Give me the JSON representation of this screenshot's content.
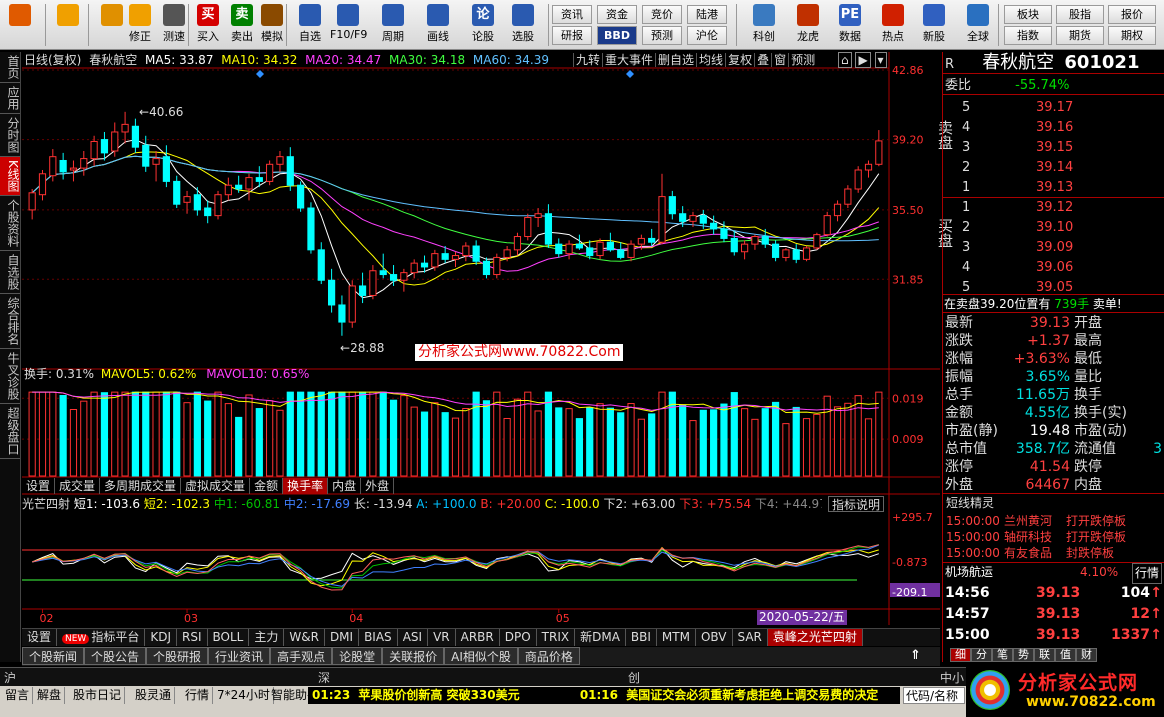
{
  "toolbar": {
    "big": [
      {
        "label": "",
        "icon": "home-grid-icon",
        "color": "#e05a00"
      },
      {
        "label": "",
        "icon": "back-arrow-icon",
        "color": "#f0a000"
      },
      {
        "label": "",
        "icon": "updown-arrow-icon",
        "color": "#e09000"
      },
      {
        "label": "修正",
        "icon": "refresh-icon",
        "color": "#f0a000"
      },
      {
        "label": "测速",
        "icon": "clock-icon",
        "color": "#555555"
      },
      {
        "label": "买入",
        "icon": "buy-icon",
        "color": "#d40000",
        "glyph": "买"
      },
      {
        "label": "卖出",
        "icon": "sell-icon",
        "color": "#008000",
        "glyph": "卖"
      },
      {
        "label": "模拟",
        "icon": "hammer-icon",
        "color": "#8a4a00"
      },
      {
        "label": "自选",
        "icon": "star-icon",
        "color": "#2a5ab0"
      },
      {
        "label": "F10/F9",
        "icon": "f10-icon",
        "color": "#2a5ab0"
      },
      {
        "label": "周期",
        "icon": "period-icon",
        "color": "#2a5ab0"
      },
      {
        "label": "画线",
        "icon": "pencil-icon",
        "color": "#2a5ab0"
      },
      {
        "label": "论股",
        "icon": "chat-icon",
        "color": "#2a5ab0",
        "glyph": "论"
      },
      {
        "label": "选股",
        "icon": "select-icon",
        "color": "#2a5ab0"
      }
    ],
    "small": [
      "资讯",
      "资金",
      "竞价",
      "陆港",
      "研报",
      "BBD",
      "预测",
      "沪伦"
    ],
    "big2": [
      {
        "label": "科创",
        "icon": "chart-icon",
        "color": "#3a7ac0"
      },
      {
        "label": "龙虎",
        "icon": "dragon-icon",
        "color": "#c03000"
      },
      {
        "label": "数据",
        "icon": "pe-icon",
        "color": "#3060c0",
        "glyph": "PE"
      },
      {
        "label": "热点",
        "icon": "hot-icon",
        "color": "#d02000"
      },
      {
        "label": "新股",
        "icon": "ipo-icon",
        "color": "#3060c0"
      },
      {
        "label": "全球",
        "icon": "globe-icon",
        "color": "#2a70c0"
      }
    ],
    "small2": [
      "板块",
      "股指",
      "报价",
      "指数",
      "期货",
      "期权"
    ]
  },
  "left_tabs": [
    "首页",
    "应用",
    "分时图",
    "K线图",
    "个股资料",
    "自选股",
    "综合排名",
    "牛叉诊股",
    "超级盘口"
  ],
  "chart": {
    "header": {
      "period": "日线(复权)",
      "name": "春秋航空",
      "ma5": "MA5: 33.87",
      "ma10": "MA10: 34.32",
      "ma20": "MA20: 34.47",
      "ma30": "MA30: 34.18",
      "ma60": "MA60: 34.39"
    },
    "top_buttons": [
      "九转",
      "重大事件",
      "删自选",
      "均线",
      "复权",
      "叠",
      "窗",
      "预测"
    ],
    "price_ticks": [
      "42.86",
      "39.20",
      "35.50",
      "31.85"
    ],
    "hi_label": "40.66",
    "lo_label": "28.88",
    "watermark": "分析家公式网www.70822.Com",
    "vol_header": {
      "hs": "换手: 0.31%",
      "mv5": "MAVOL5: 0.62%",
      "mv10": "MAVOL10: 0.65%"
    },
    "vol_ticks": [
      "0.019",
      "0.009"
    ],
    "vol_tabs": [
      "设置",
      "成交量",
      "多周期成交量",
      "虚拟成交量",
      "金额",
      "换手率",
      "内盘",
      "外盘"
    ],
    "ind_header": {
      "name": "光芒四射",
      "s1": "短1: -103.6",
      "s2": "短2: -102.3",
      "z1": "中1: -60.81",
      "z2": "中2: -17.69",
      "l": "长: -13.94",
      "a": "A: +100.0",
      "b": "B: +20.00",
      "c": "C: -100.0",
      "x2": "下2: +63.00",
      "x3": "下3: +75.54",
      "x4": "下4: +44.97"
    },
    "ind_button": "指标说明",
    "ind_ticks": [
      "+295.7",
      "-0.873",
      "-209.1"
    ],
    "months": [
      "02",
      "03",
      "04",
      "05"
    ],
    "date_label": "2020-05-22/五"
  },
  "chart_data": {
    "type": "candlestick",
    "ohlc": [
      [
        35.5,
        36.6,
        35.0,
        36.4
      ],
      [
        36.3,
        37.6,
        36.0,
        37.4
      ],
      [
        37.3,
        38.7,
        37.0,
        38.3
      ],
      [
        38.1,
        38.5,
        37.1,
        37.5
      ],
      [
        37.6,
        38.1,
        37.0,
        37.7
      ],
      [
        37.7,
        38.6,
        37.3,
        38.2
      ],
      [
        38.2,
        39.4,
        37.8,
        39.1
      ],
      [
        39.2,
        39.6,
        38.1,
        38.5
      ],
      [
        38.6,
        40.1,
        38.3,
        39.6
      ],
      [
        39.6,
        40.66,
        39.0,
        40.0
      ],
      [
        39.9,
        40.3,
        38.5,
        38.8
      ],
      [
        38.9,
        39.4,
        37.5,
        37.8
      ],
      [
        37.9,
        38.6,
        37.0,
        38.2
      ],
      [
        38.3,
        38.9,
        36.7,
        37.0
      ],
      [
        37.0,
        37.3,
        35.6,
        35.8
      ],
      [
        35.9,
        36.5,
        35.3,
        36.2
      ],
      [
        36.3,
        36.7,
        35.2,
        35.5
      ],
      [
        35.6,
        36.0,
        34.8,
        35.2
      ],
      [
        35.2,
        36.5,
        35.0,
        36.3
      ],
      [
        36.3,
        37.2,
        36.0,
        36.8
      ],
      [
        36.8,
        37.3,
        36.4,
        36.6
      ],
      [
        36.6,
        37.4,
        36.0,
        37.2
      ],
      [
        37.2,
        37.8,
        36.7,
        37.0
      ],
      [
        37.0,
        38.1,
        36.8,
        37.9
      ],
      [
        37.9,
        38.6,
        37.5,
        38.3
      ],
      [
        38.3,
        38.8,
        36.5,
        36.8
      ],
      [
        36.8,
        37.0,
        35.4,
        35.6
      ],
      [
        35.6,
        35.9,
        33.2,
        33.4
      ],
      [
        33.4,
        33.8,
        31.6,
        31.8
      ],
      [
        31.8,
        32.4,
        30.1,
        30.5
      ],
      [
        30.5,
        31.0,
        28.88,
        29.6
      ],
      [
        29.6,
        31.8,
        29.3,
        31.5
      ],
      [
        31.5,
        32.2,
        30.6,
        31.0
      ],
      [
        31.0,
        32.6,
        30.8,
        32.3
      ],
      [
        32.3,
        33.2,
        31.9,
        32.1
      ],
      [
        32.1,
        32.6,
        31.5,
        31.8
      ],
      [
        31.8,
        32.4,
        31.2,
        32.2
      ],
      [
        32.2,
        32.9,
        31.9,
        32.7
      ],
      [
        32.7,
        33.1,
        32.2,
        32.5
      ],
      [
        32.5,
        33.4,
        32.3,
        33.2
      ],
      [
        33.2,
        33.6,
        32.7,
        32.9
      ],
      [
        32.9,
        33.3,
        32.5,
        33.1
      ],
      [
        33.1,
        33.8,
        32.8,
        33.6
      ],
      [
        33.6,
        33.9,
        32.6,
        32.8
      ],
      [
        32.8,
        33.0,
        31.9,
        32.1
      ],
      [
        32.1,
        33.2,
        31.9,
        33.0
      ],
      [
        33.0,
        33.6,
        32.8,
        33.4
      ],
      [
        33.4,
        34.3,
        33.1,
        34.1
      ],
      [
        34.1,
        35.3,
        33.9,
        35.1
      ],
      [
        35.1,
        35.6,
        34.6,
        35.3
      ],
      [
        35.3,
        35.8,
        33.5,
        33.7
      ],
      [
        33.7,
        34.0,
        33.0,
        33.2
      ],
      [
        33.2,
        33.9,
        32.9,
        33.7
      ],
      [
        33.7,
        34.2,
        33.4,
        33.5
      ],
      [
        33.5,
        33.9,
        32.9,
        33.1
      ],
      [
        33.1,
        34.0,
        32.9,
        33.8
      ],
      [
        33.8,
        34.3,
        33.3,
        33.4
      ],
      [
        33.4,
        33.8,
        32.9,
        33.0
      ],
      [
        33.0,
        33.9,
        32.8,
        33.7
      ],
      [
        33.7,
        34.2,
        33.4,
        34.0
      ],
      [
        34.0,
        34.5,
        33.6,
        33.8
      ],
      [
        33.8,
        37.4,
        33.7,
        36.2
      ],
      [
        36.2,
        36.5,
        35.0,
        35.3
      ],
      [
        35.3,
        35.7,
        34.6,
        34.9
      ],
      [
        34.9,
        35.4,
        34.6,
        35.2
      ],
      [
        35.2,
        35.5,
        34.5,
        34.8
      ],
      [
        34.8,
        35.2,
        34.2,
        34.5
      ],
      [
        34.5,
        34.9,
        33.8,
        34.0
      ],
      [
        34.0,
        34.4,
        33.1,
        33.3
      ],
      [
        33.3,
        33.9,
        32.9,
        33.7
      ],
      [
        33.7,
        34.2,
        33.4,
        34.1
      ],
      [
        34.1,
        34.5,
        33.5,
        33.7
      ],
      [
        33.7,
        33.9,
        32.8,
        33.0
      ],
      [
        33.0,
        33.5,
        32.8,
        33.4
      ],
      [
        33.4,
        33.7,
        32.7,
        32.9
      ],
      [
        32.9,
        33.6,
        32.8,
        33.5
      ],
      [
        33.5,
        34.3,
        33.4,
        34.2
      ],
      [
        34.2,
        35.4,
        34.1,
        35.2
      ],
      [
        35.2,
        36.0,
        34.9,
        35.8
      ],
      [
        35.8,
        36.8,
        35.6,
        36.6
      ],
      [
        36.6,
        37.8,
        36.4,
        37.6
      ],
      [
        37.6,
        38.1,
        37.2,
        37.9
      ],
      [
        37.9,
        39.7,
        37.8,
        39.13
      ]
    ],
    "ylim": [
      27.5,
      42.86
    ]
  },
  "quote": {
    "code_label": "R",
    "name": "春秋航空",
    "code": "601021",
    "wb_label": "委比",
    "wb": "-55.74%",
    "sell_label": "卖盘",
    "buy_label": "买盘",
    "sells": [
      {
        "n": "5",
        "p": "39.17"
      },
      {
        "n": "4",
        "p": "39.16"
      },
      {
        "n": "3",
        "p": "39.15"
      },
      {
        "n": "2",
        "p": "39.14"
      },
      {
        "n": "1",
        "p": "39.13"
      }
    ],
    "buys": [
      {
        "n": "1",
        "p": "39.12"
      },
      {
        "n": "2",
        "p": "39.10"
      },
      {
        "n": "3",
        "p": "39.09"
      },
      {
        "n": "4",
        "p": "39.06"
      },
      {
        "n": "5",
        "p": "39.05"
      }
    ],
    "sell_info_a": "在卖盘39.20位置有",
    "sell_info_b": "739手",
    "sell_info_c": "卖单!",
    "stats": [
      {
        "l1": "最新",
        "v1": "39.13",
        "c1": "red",
        "l2": "开盘",
        "v2": "",
        "c2": "red"
      },
      {
        "l1": "涨跌",
        "v1": "+1.37",
        "c1": "red",
        "l2": "最高",
        "v2": "",
        "c2": "red"
      },
      {
        "l1": "涨幅",
        "v1": "+3.63%",
        "c1": "red",
        "l2": "最低",
        "v2": "",
        "c2": "red"
      },
      {
        "l1": "振幅",
        "v1": "3.65%",
        "c1": "cyn",
        "l2": "量比",
        "v2": "",
        "c2": "red"
      },
      {
        "l1": "总手",
        "v1": "11.65万",
        "c1": "cyn",
        "l2": "换手",
        "v2": "",
        "c2": "cyn"
      },
      {
        "l1": "金额",
        "v1": "4.55亿",
        "c1": "cyn",
        "l2": "换手(实)",
        "v2": "",
        "c2": "cyn"
      },
      {
        "l1": "市盈(静)",
        "v1": "19.48",
        "c1": "wht",
        "l2": "市盈(动)",
        "v2": "",
        "c2": "wht"
      },
      {
        "l1": "总市值",
        "v1": "358.7亿",
        "c1": "cyn",
        "l2": "流通值",
        "v2": "3",
        "c2": "cyn"
      },
      {
        "l1": "涨停",
        "v1": "41.54",
        "c1": "red",
        "l2": "跌停",
        "v2": "",
        "c2": "grn"
      },
      {
        "l1": "外盘",
        "v1": "64467",
        "c1": "red",
        "l2": "内盘",
        "v2": "",
        "c2": "grn"
      }
    ],
    "elves_title": "短线精灵",
    "elves": [
      {
        "t": "15:00:00",
        "s": "兰州黄河",
        "e": "打开跌停板"
      },
      {
        "t": "15:00:00",
        "s": "轴研科技",
        "e": "打开跌停板"
      },
      {
        "t": "15:00:00",
        "s": "有友食品",
        "e": "封跌停板"
      }
    ],
    "sector": {
      "name": "机场航运",
      "pct": "4.10%",
      "btn": "行情"
    },
    "ticks": [
      {
        "t": "14:56",
        "p": "39.13",
        "v": "104",
        "d": "↑"
      },
      {
        "t": "14:57",
        "p": "39.13",
        "v": "12",
        "d": "↑"
      },
      {
        "t": "15:00",
        "p": "39.13",
        "v": "1337",
        "d": "↑"
      }
    ],
    "tabs": [
      "细",
      "分",
      "笔",
      "势",
      "联",
      "值",
      "财"
    ]
  },
  "bottom_tabs": [
    "设置",
    "指标平台",
    "KDJ",
    "RSI",
    "BOLL",
    "主力",
    "W&R",
    "DMI",
    "BIAS",
    "ASI",
    "VR",
    "ARBR",
    "DPO",
    "TRIX",
    "新DMA",
    "BBI",
    "MTM",
    "OBV",
    "SAR",
    "袁峰之光芒四射"
  ],
  "new_badge": "NEW",
  "news_tabs": [
    "个股新闻",
    "个股公告",
    "个股研报",
    "行业资讯",
    "高手观点",
    "论股堂",
    "关联报价",
    "AI相似个股",
    "商品价格"
  ],
  "market": {
    "sh": "沪",
    "sz": "深",
    "cy": "创",
    "zz": "中小"
  },
  "status": {
    "items": [
      "留言",
      "解盘",
      "股市日记",
      "股灵通",
      "行情",
      "7*24小时",
      "智能助手"
    ],
    "news1_time": "01:23",
    "news1": "苹果股价创新高 突破330美元",
    "news2_time": "01:16",
    "news2": "美国证交会必须重新考虑拒绝上调交易费的决定",
    "code_label": "代码/名称",
    "logo_text": "分析家公式网",
    "logo_url": "www.70822.com"
  }
}
